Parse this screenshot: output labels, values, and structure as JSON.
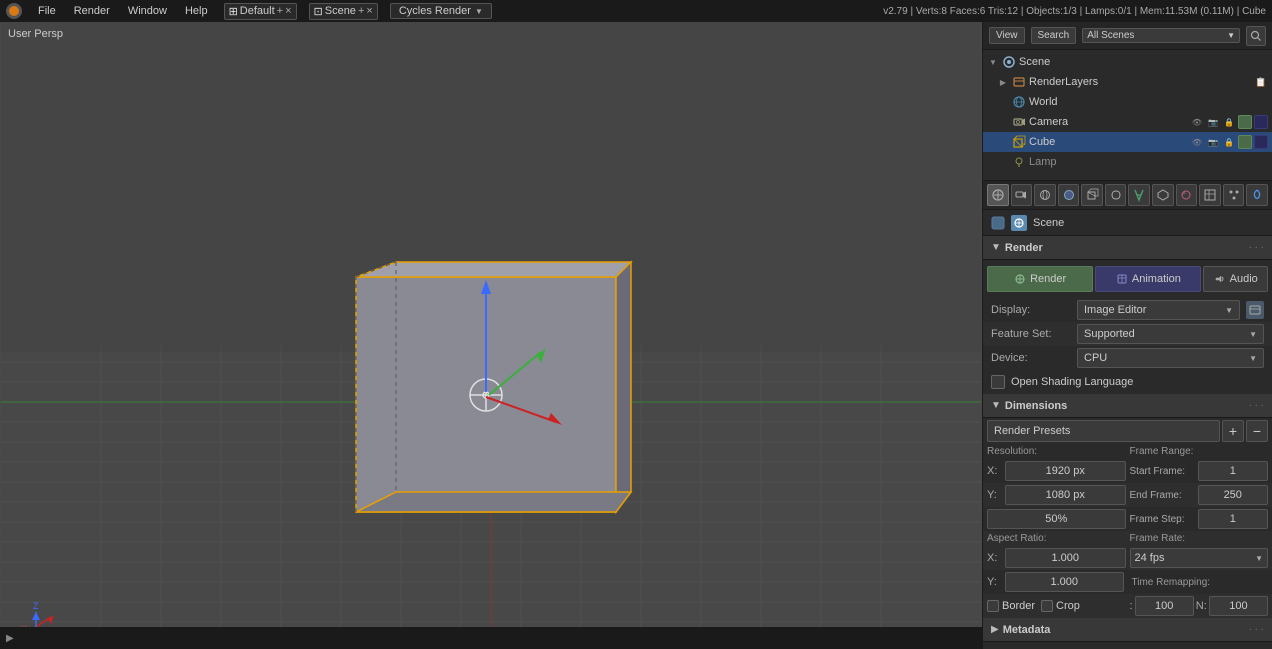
{
  "topbar": {
    "icon": "●",
    "menus": [
      "File",
      "Render",
      "Window",
      "Help"
    ],
    "layout_icon": "⊞",
    "layout_name": "Default",
    "layout_plus": "+",
    "layout_x": "×",
    "window_icon": "⊡",
    "window_name": "Scene",
    "window_plus": "+",
    "window_x": "×",
    "engine": "Cycles Render",
    "engine_arrow": "▼",
    "blender_icon": "🔷",
    "info": "v2.79 | Verts:8  Faces:6  Tris:12 | Objects:1/3 | Lamps:0/1 | Mem:11.53M (0.11M) | Cube"
  },
  "viewport": {
    "label": "User Persp"
  },
  "outliner": {
    "view_btn": "View",
    "search_btn": "Search",
    "scenes_label": "All Scenes",
    "search_icon": "🔍",
    "tree": [
      {
        "level": 1,
        "icon": "🎬",
        "label": "Scene",
        "expand": true,
        "actions": []
      },
      {
        "level": 2,
        "icon": "📷",
        "label": "RenderLayers",
        "expand": false,
        "actions": [
          "📋"
        ]
      },
      {
        "level": 3,
        "icon": "🌍",
        "label": "World",
        "expand": false,
        "actions": []
      },
      {
        "level": 3,
        "icon": "📷",
        "label": "Camera",
        "expand": false,
        "actions": [
          "👁",
          "📷",
          "🔒"
        ]
      },
      {
        "level": 3,
        "icon": "📦",
        "label": "Cube",
        "expand": false,
        "selected": true,
        "actions": [
          "👁",
          "📷",
          "🔒"
        ]
      },
      {
        "level": 3,
        "icon": "💡",
        "label": "Lamp",
        "expand": false,
        "actions": []
      }
    ]
  },
  "properties": {
    "toolbar_icons": [
      "⚙",
      "📷",
      "🎬",
      "🌍",
      "📦",
      "✏",
      "🔧",
      "🔗",
      "⚡",
      "🎨",
      "📐",
      "💡",
      "🌊",
      "🔒",
      "⭐",
      "📋"
    ],
    "scene_label": "Scene",
    "render_section": "Render",
    "render_btn": "Render",
    "animation_btn": "Animation",
    "audio_btn": "Audio",
    "display_label": "Display:",
    "display_value": "Image Editor",
    "display_icon": "📋",
    "feature_set_label": "Feature Set:",
    "feature_set_value": "Supported",
    "device_label": "Device:",
    "device_value": "CPU",
    "open_shading_label": "Open Shading Language",
    "dimensions_section": "Dimensions",
    "render_presets": "Render Presets",
    "presets_add": "+",
    "presets_remove": "−",
    "resolution_label": "Resolution:",
    "x_label": "X:",
    "x_value": "1920 px",
    "y_label": "Y:",
    "y_value": "1080 px",
    "pct_value": "50%",
    "frame_range_label": "Frame Range:",
    "start_frame_label": "Start Frame:",
    "start_frame_value": "1",
    "end_frame_label": "End Frame:",
    "end_frame_value": "250",
    "frame_step_label": "Frame Step:",
    "frame_step_value": "1",
    "aspect_ratio_label": "Aspect Ratio:",
    "aspect_x_label": "X:",
    "aspect_x_value": "1.000",
    "aspect_y_label": "Y:",
    "aspect_y_value": "1.000",
    "frame_rate_label": "Frame Rate:",
    "fps_value": "24 fps",
    "time_remapping_label": "Time Remapping:",
    "old_label": ":",
    "old_value": "100",
    "new_label": "N:",
    "new_value": "100",
    "border_label": "Border",
    "crop_label": "Crop",
    "metadata_label": "Metadata",
    "metadata_arrow": "▶"
  }
}
